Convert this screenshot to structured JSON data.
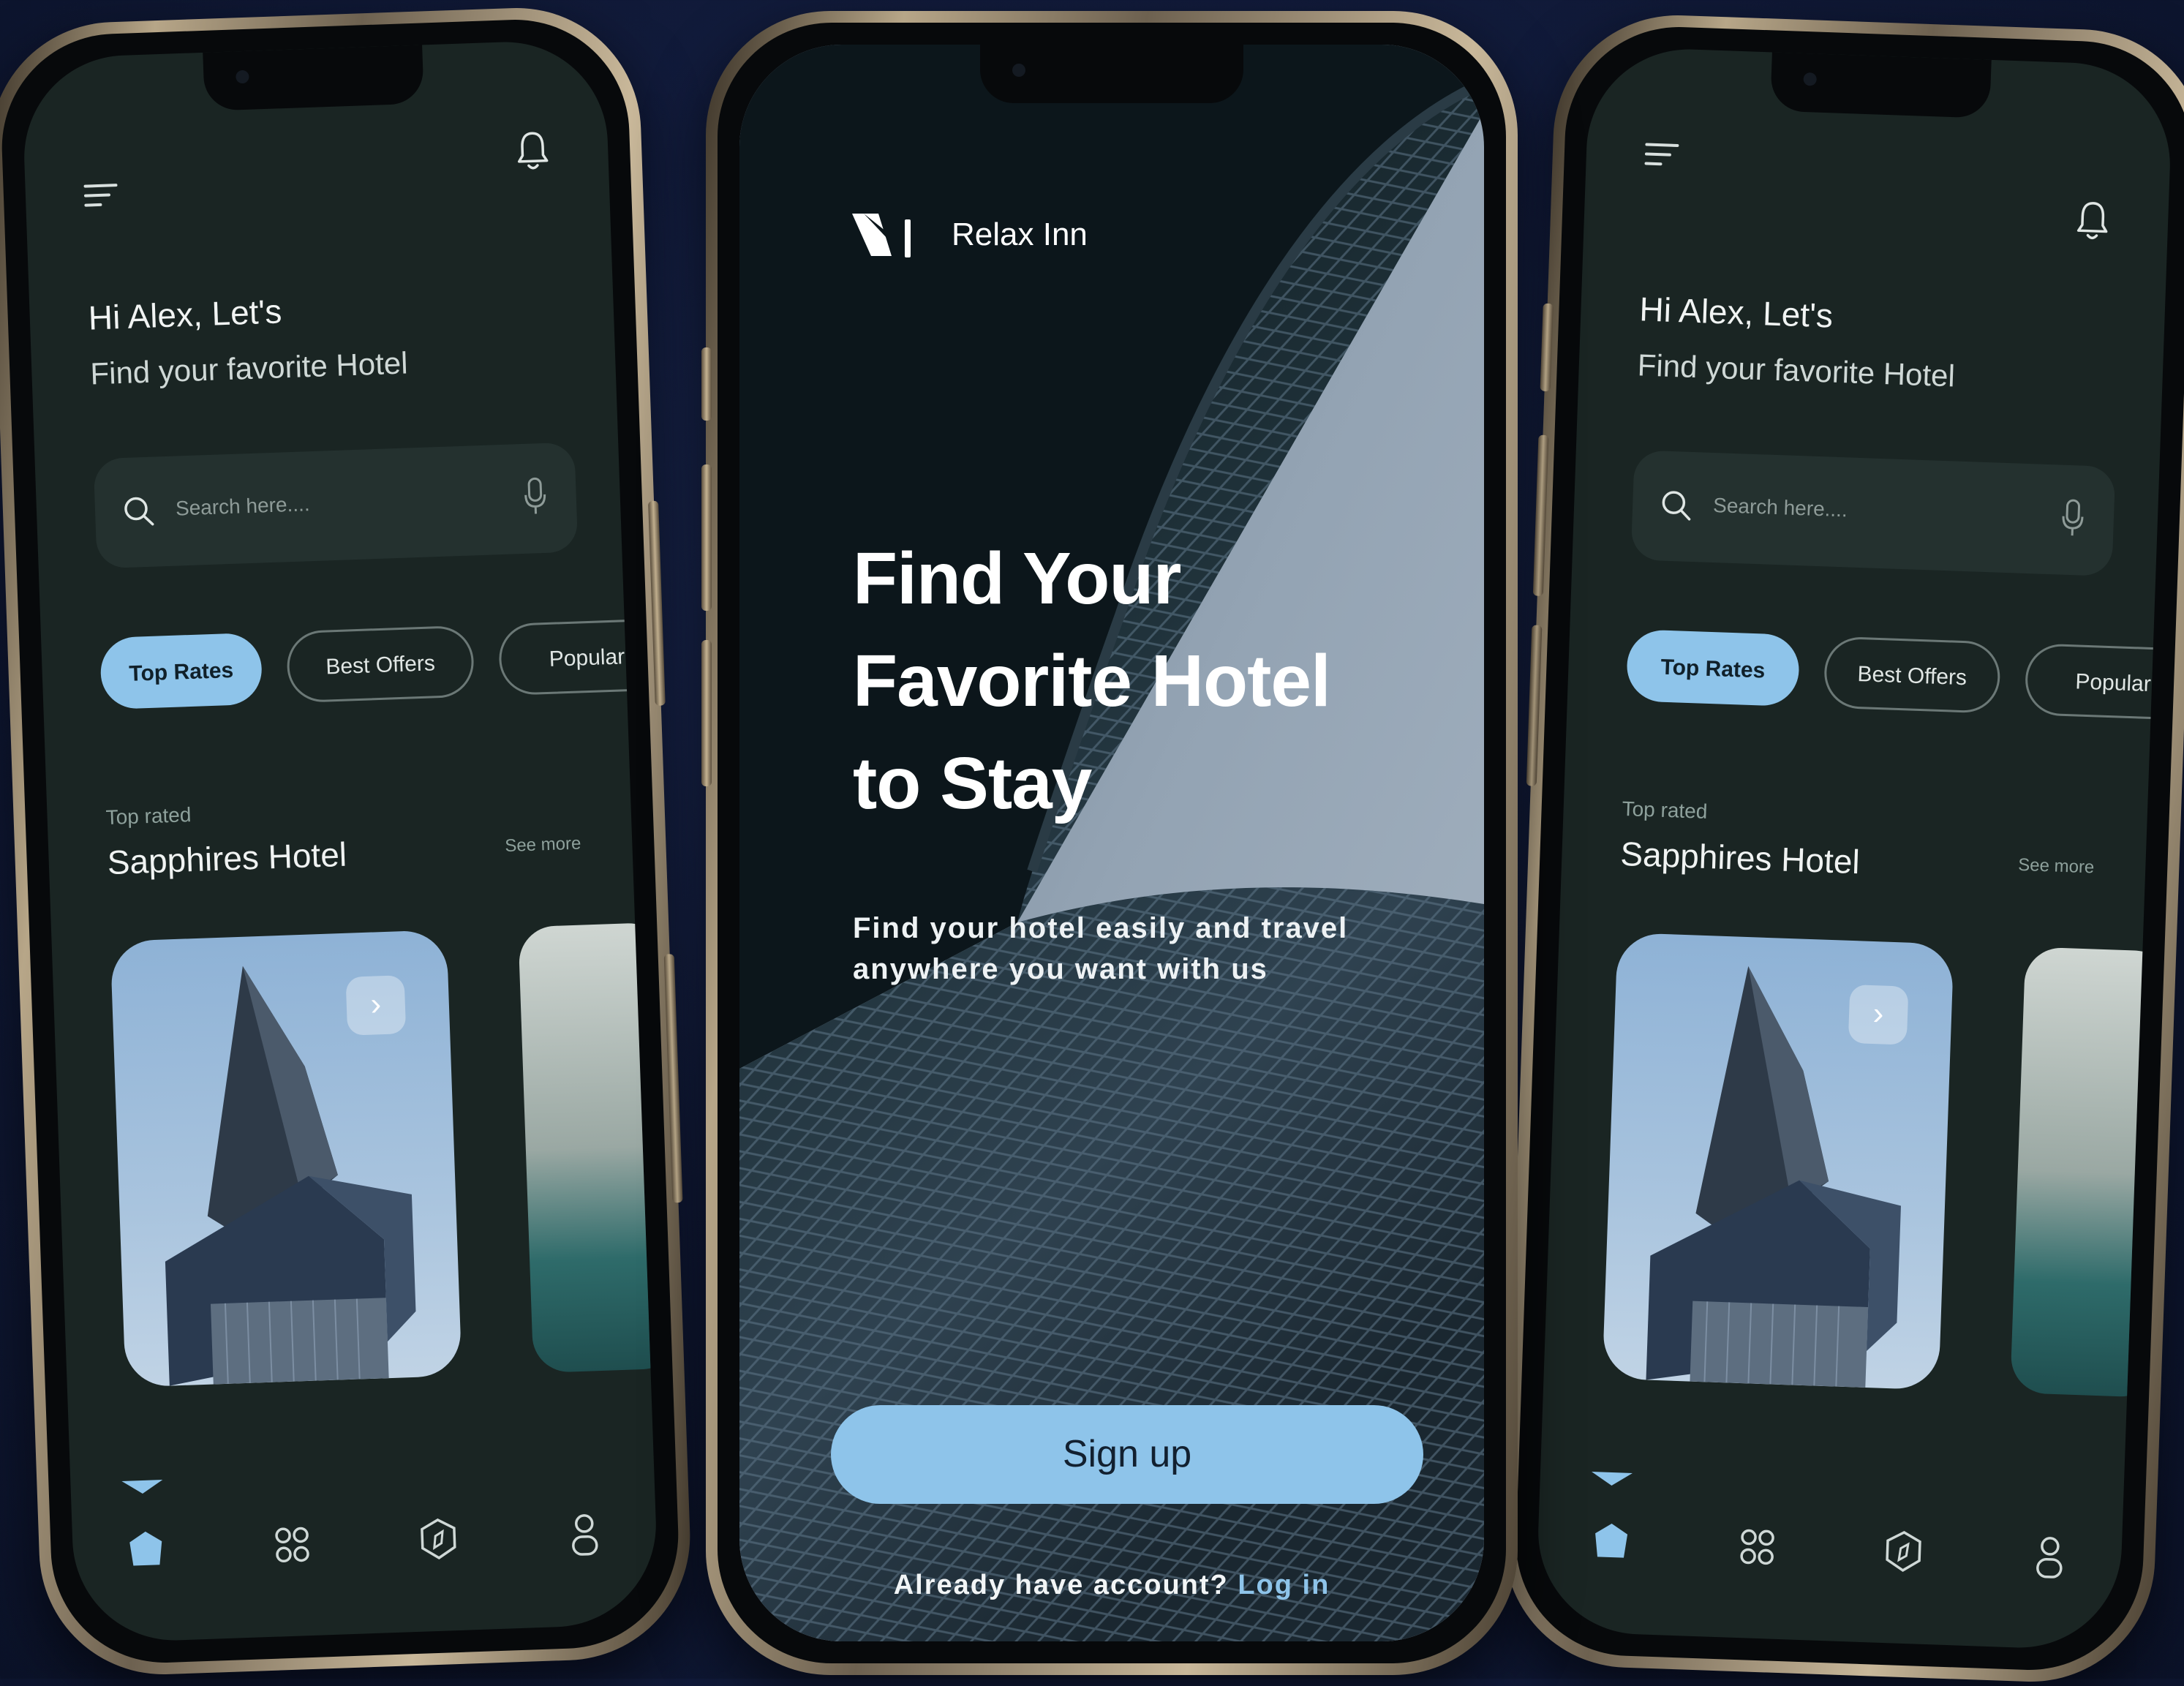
{
  "colors": {
    "accent": "#8ec4ea",
    "screen_bg": "#1a2523",
    "page_bg": "#121c3d",
    "frame_gold": "#b7a688"
  },
  "left_phone": {
    "greeting": "Hi Alex, Let's",
    "subtitle": "Find your favorite Hotel",
    "search_placeholder": "Search here....",
    "chips": [
      "Top Rates",
      "Best Offers",
      "Popular"
    ],
    "active_chip": "Top Rates",
    "section_label": "Top rated",
    "section_title": "Sapphires Hotel",
    "see_more": "See more",
    "nav_icons": [
      "home-icon",
      "grid-icon",
      "compass-icon",
      "profile-icon"
    ]
  },
  "center_phone": {
    "brand_name": "Relax Inn",
    "hero_lines": [
      "Find Your",
      "Favorite Hotel",
      "to Stay"
    ],
    "sub_text": "Find your hotel easily and travel anywhere you want with us",
    "signup_label": "Sign up",
    "login_prompt": "Already have account?",
    "login_link": "Log in"
  },
  "right_phone": {
    "greeting": "Hi Alex, Let's",
    "subtitle": "Find your favorite Hotel",
    "search_placeholder": "Search here....",
    "chips": [
      "Top Rates",
      "Best Offers",
      "Popular"
    ],
    "active_chip": "Top Rates",
    "section_label": "Top rated",
    "section_title": "Sapphires Hotel",
    "see_more": "See more",
    "nav_icons": [
      "home-icon",
      "grid-icon",
      "compass-icon",
      "profile-icon"
    ]
  }
}
